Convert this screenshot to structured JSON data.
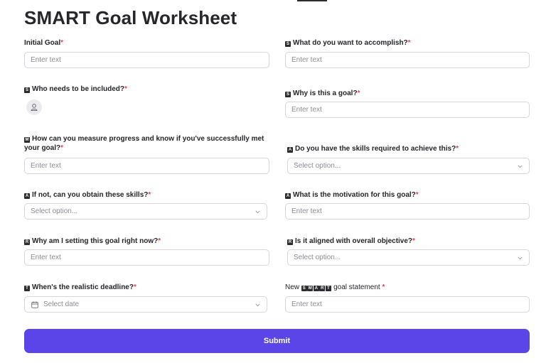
{
  "page": {
    "title": "SMART Goal Worksheet"
  },
  "placeholders": {
    "text": "Enter text",
    "select": "Select option...",
    "date": "Select date"
  },
  "fields": {
    "initial_goal": {
      "label": "Initial Goal",
      "req": "*"
    },
    "accomplish": {
      "badge": "S",
      "label": "What do you want to accomplish?",
      "req": "*"
    },
    "who_included": {
      "badge": "S",
      "label": "Who needs to be included?",
      "req": "*"
    },
    "why_goal": {
      "badge": "S",
      "label": "Why is this a goal?",
      "req": "*"
    },
    "measure": {
      "badge": "M",
      "label": "How can you measure progress and know if you've successfully met your goal?",
      "req": "*"
    },
    "skills": {
      "badge": "A",
      "label": "Do you have the skills required to achieve this?",
      "req": "*"
    },
    "obtain_skills": {
      "badge": "A",
      "label": "If not, can you obtain these skills?",
      "req": "*"
    },
    "motivation": {
      "badge": "A",
      "label": "What is the motivation for this goal?",
      "req": "*"
    },
    "why_now": {
      "badge": "R",
      "label": "Why am I setting this goal right now?",
      "req": "*"
    },
    "aligned": {
      "badge": "R",
      "label": "Is it aligned with overall objective?",
      "req": "*"
    },
    "deadline": {
      "badge": "T",
      "label": "When's the realistic deadline?",
      "req": "*"
    },
    "statement": {
      "label_prefix": "New",
      "badges": [
        "S",
        "M",
        "A",
        "R",
        "T"
      ],
      "label_suffix": "goal statement",
      "req": "*"
    }
  },
  "submit": {
    "label": "Submit"
  },
  "colors": {
    "accent": "#5b45e8",
    "required": "#e5484d",
    "border": "#d6d6dc"
  }
}
